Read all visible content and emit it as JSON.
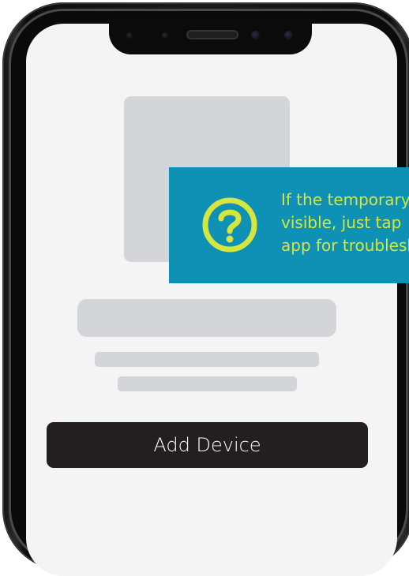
{
  "colors": {
    "screen_background": "#f4f4f5",
    "placeholder": "#d3d5d9",
    "button_background": "#231f20",
    "button_text": "#ffffff",
    "tooltip_background": "#0f91b5",
    "tooltip_accent": "#d5e63f",
    "phone_frame": "#111111"
  },
  "screen": {
    "add_device_button_label": "Add Device"
  },
  "tooltip": {
    "icon": "question-circle-icon",
    "lines": [
      "If the temporary",
      "visible, just tap",
      "app for troublesh"
    ]
  }
}
